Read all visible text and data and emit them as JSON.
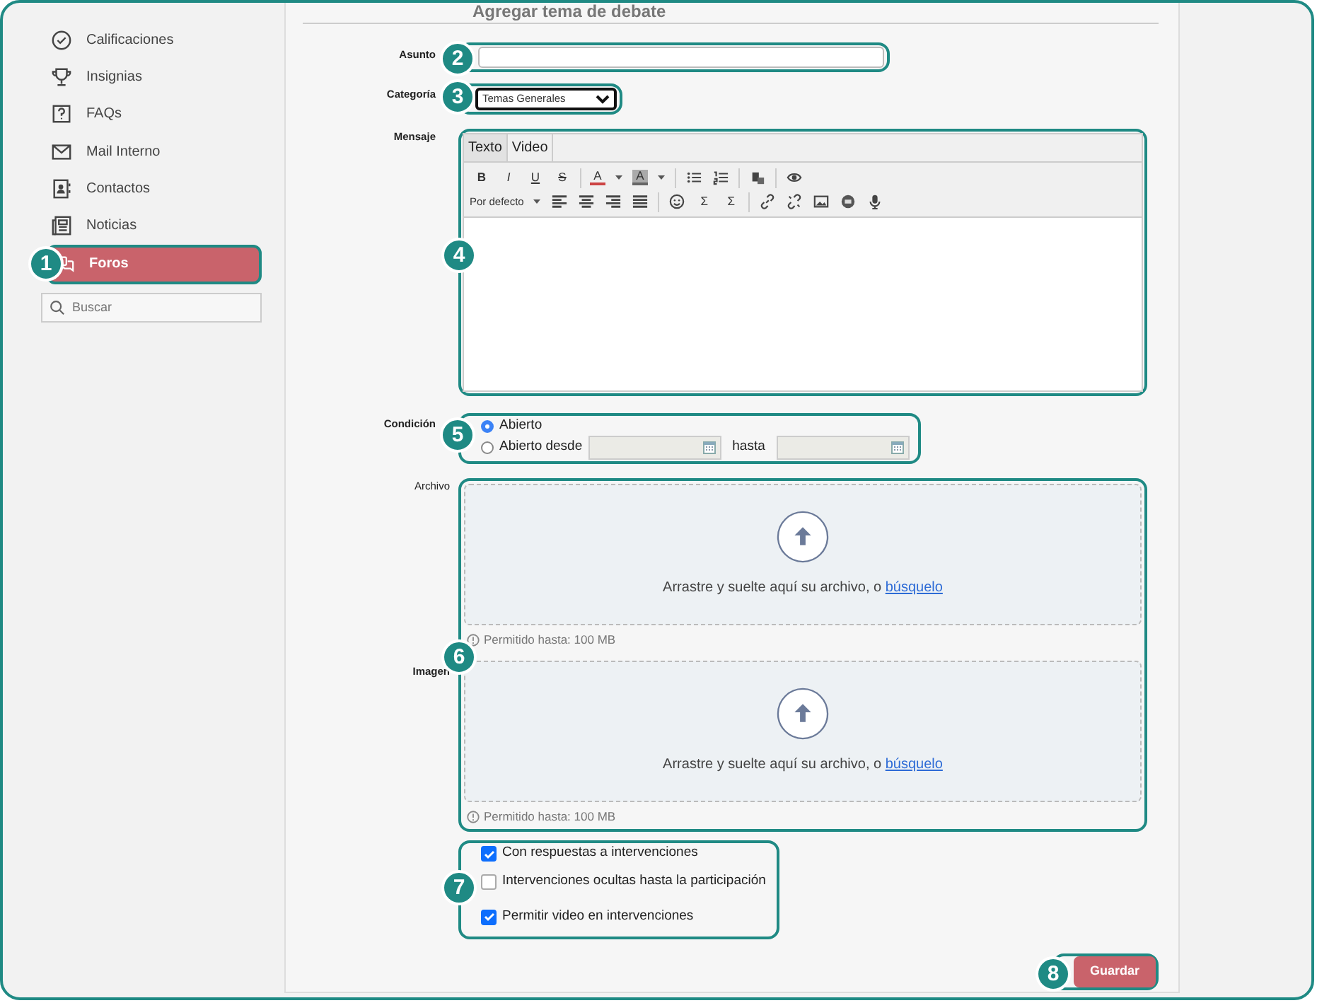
{
  "sidebar": {
    "items": [
      {
        "label": "Calificaciones",
        "selected": false
      },
      {
        "label": "Insignias",
        "selected": false
      },
      {
        "label": "FAQs",
        "selected": false
      },
      {
        "label": "Mail Interno",
        "selected": false
      },
      {
        "label": "Contactos",
        "selected": false
      },
      {
        "label": "Noticias",
        "selected": false
      },
      {
        "label": "Foros",
        "selected": true
      }
    ],
    "search": {
      "placeholder": "Buscar"
    }
  },
  "form": {
    "title": "Agregar tema de debate",
    "subject": {
      "label": "Asunto"
    },
    "category": {
      "label": "Categoría",
      "value": "Temas Generales"
    },
    "message": {
      "label": "Mensaje",
      "tabs": [
        {
          "label": "Texto",
          "selected": true
        },
        {
          "label": "Video",
          "selected": false
        }
      ],
      "toolbar": {
        "letters": [
          "B",
          "I",
          "U",
          "S"
        ],
        "text_color": "A",
        "highlight": "A",
        "font_size": "Por defecto",
        "symbols": [
          "Σ",
          "Σ"
        ]
      }
    },
    "condition": {
      "label": "Condición",
      "options": [
        {
          "label": "Abierto",
          "selected": true
        },
        {
          "label": "Abierto desde",
          "selected": false
        }
      ],
      "until_label": "hasta",
      "dates": [
        {
          "disabled": true
        },
        {
          "disabled": true
        }
      ]
    },
    "uploads": [
      {
        "label": "Archivo",
        "prompt": "Arrastre y suelte aquí su archivo, o",
        "link": "búsquelo",
        "hint": "Permitido hasta: 100 MB"
      },
      {
        "label": "Imagen",
        "prompt": "Arrastre y suelte aquí su archivo, o",
        "link": "búsquelo",
        "hint": "Permitido hasta: 100 MB"
      }
    ],
    "options": [
      {
        "label": "Con respuestas a intervenciones",
        "checked": true
      },
      {
        "label": "Intervenciones ocultas hasta la participación",
        "checked": false
      },
      {
        "label": "Permitir video en intervenciones",
        "checked": true
      }
    ],
    "save_button": "Guardar"
  },
  "callouts": [
    "1",
    "2",
    "3",
    "4",
    "5",
    "6",
    "7",
    "8"
  ]
}
